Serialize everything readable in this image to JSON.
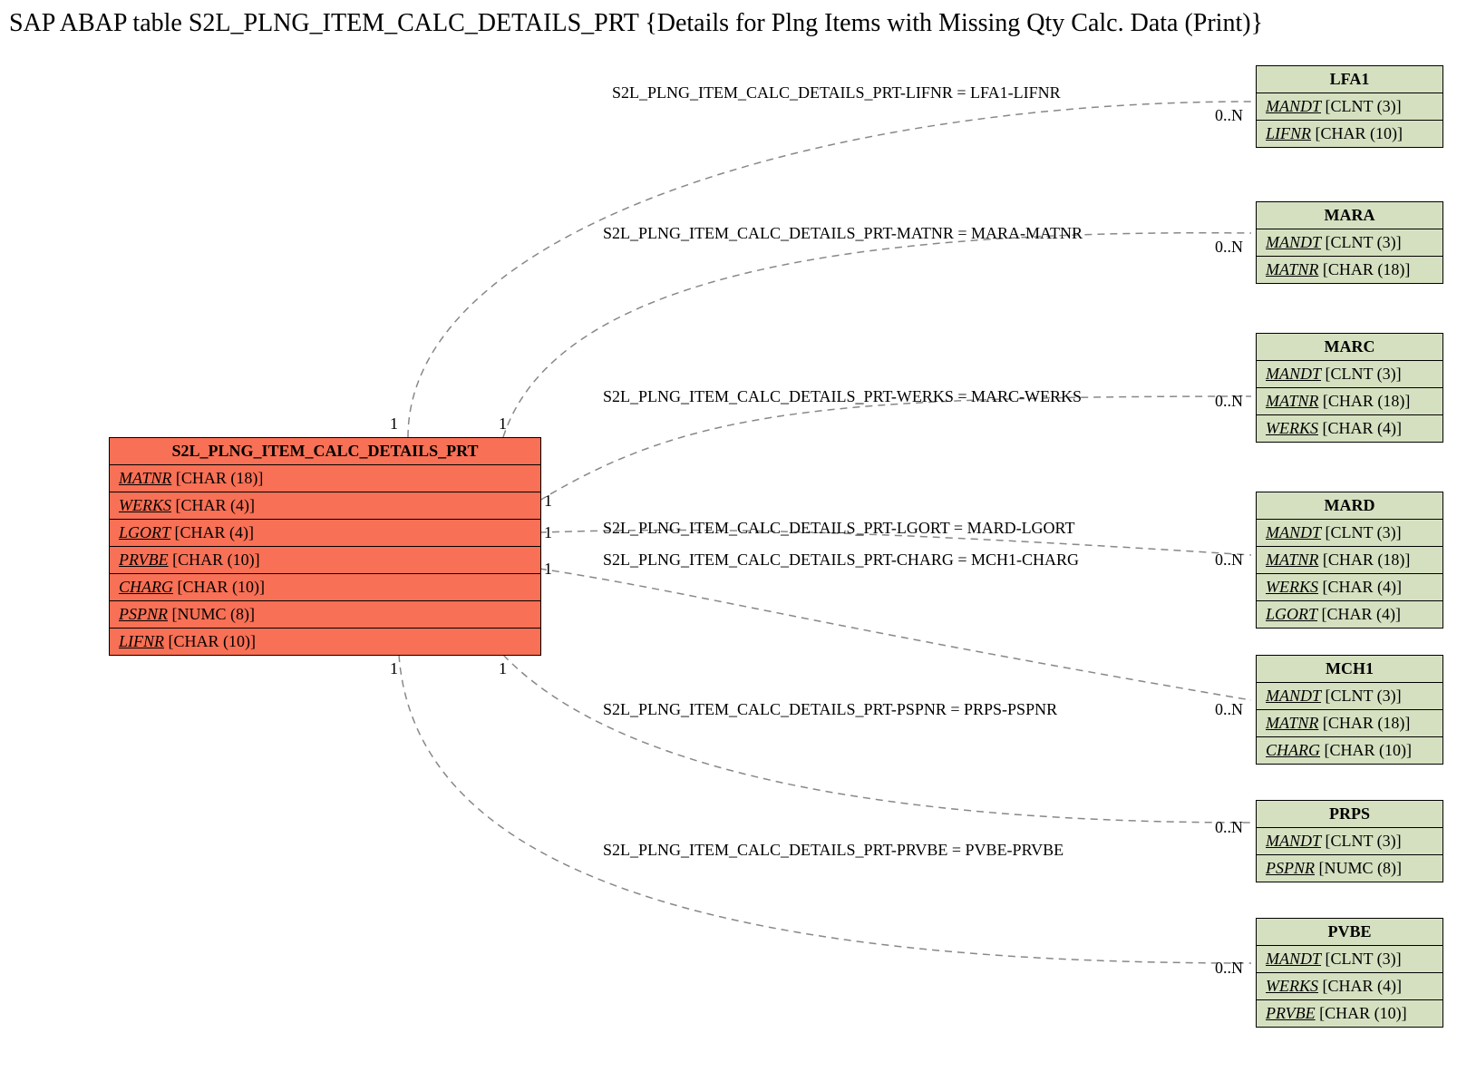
{
  "title": "SAP ABAP table S2L_PLNG_ITEM_CALC_DETAILS_PRT {Details for Plng Items with Missing Qty Calc. Data (Print)}",
  "main": {
    "name": "S2L_PLNG_ITEM_CALC_DETAILS_PRT",
    "fields": [
      {
        "f": "MATNR",
        "t": "[CHAR (18)]"
      },
      {
        "f": "WERKS",
        "t": "[CHAR (4)]"
      },
      {
        "f": "LGORT",
        "t": "[CHAR (4)]"
      },
      {
        "f": "PRVBE",
        "t": "[CHAR (10)]"
      },
      {
        "f": "CHARG",
        "t": "[CHAR (10)]"
      },
      {
        "f": "PSPNR",
        "t": "[NUMC (8)]"
      },
      {
        "f": "LIFNR",
        "t": "[CHAR (10)]"
      }
    ]
  },
  "targets": [
    {
      "name": "LFA1",
      "fields": [
        {
          "f": "MANDT",
          "t": "[CLNT (3)]"
        },
        {
          "f": "LIFNR",
          "t": "[CHAR (10)]"
        }
      ]
    },
    {
      "name": "MARA",
      "fields": [
        {
          "f": "MANDT",
          "t": "[CLNT (3)]"
        },
        {
          "f": "MATNR",
          "t": "[CHAR (18)]"
        }
      ]
    },
    {
      "name": "MARC",
      "fields": [
        {
          "f": "MANDT",
          "t": "[CLNT (3)]"
        },
        {
          "f": "MATNR",
          "t": "[CHAR (18)]"
        },
        {
          "f": "WERKS",
          "t": "[CHAR (4)]"
        }
      ]
    },
    {
      "name": "MARD",
      "fields": [
        {
          "f": "MANDT",
          "t": "[CLNT (3)]"
        },
        {
          "f": "MATNR",
          "t": "[CHAR (18)]"
        },
        {
          "f": "WERKS",
          "t": "[CHAR (4)]"
        },
        {
          "f": "LGORT",
          "t": "[CHAR (4)]"
        }
      ]
    },
    {
      "name": "MCH1",
      "fields": [
        {
          "f": "MANDT",
          "t": "[CLNT (3)]"
        },
        {
          "f": "MATNR",
          "t": "[CHAR (18)]"
        },
        {
          "f": "CHARG",
          "t": "[CHAR (10)]"
        }
      ]
    },
    {
      "name": "PRPS",
      "fields": [
        {
          "f": "MANDT",
          "t": "[CLNT (3)]"
        },
        {
          "f": "PSPNR",
          "t": "[NUMC (8)]"
        }
      ]
    },
    {
      "name": "PVBE",
      "fields": [
        {
          "f": "MANDT",
          "t": "[CLNT (3)]"
        },
        {
          "f": "WERKS",
          "t": "[CHAR (4)]"
        },
        {
          "f": "PRVBE",
          "t": "[CHAR (10)]"
        }
      ]
    }
  ],
  "rels": [
    {
      "label": "S2L_PLNG_ITEM_CALC_DETAILS_PRT-LIFNR = LFA1-LIFNR",
      "lc": "1",
      "rc": "0..N"
    },
    {
      "label": "S2L_PLNG_ITEM_CALC_DETAILS_PRT-MATNR = MARA-MATNR",
      "lc": "1",
      "rc": "0..N"
    },
    {
      "label": "S2L_PLNG_ITEM_CALC_DETAILS_PRT-WERKS = MARC-WERKS",
      "lc": "1",
      "rc": "0..N"
    },
    {
      "label": "S2L_PLNG_ITEM_CALC_DETAILS_PRT-LGORT = MARD-LGORT",
      "lc": "1",
      "rc": "0..N"
    },
    {
      "label": "S2L_PLNG_ITEM_CALC_DETAILS_PRT-CHARG = MCH1-CHARG",
      "lc": "1",
      "rc": "0..N"
    },
    {
      "label": "S2L_PLNG_ITEM_CALC_DETAILS_PRT-PSPNR = PRPS-PSPNR",
      "lc": "1",
      "rc": "0..N"
    },
    {
      "label": "S2L_PLNG_ITEM_CALC_DETAILS_PRT-PRVBE = PVBE-PRVBE",
      "lc": "1",
      "rc": "0..N"
    }
  ]
}
